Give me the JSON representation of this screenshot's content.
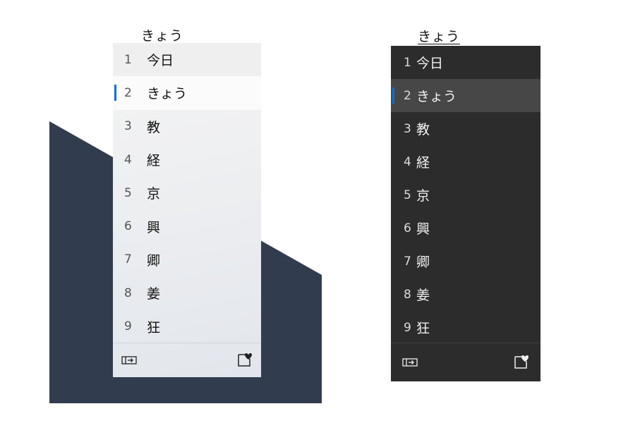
{
  "light_window": {
    "reading": "きょう",
    "candidates": [
      {
        "num": "1",
        "text": "今日"
      },
      {
        "num": "2",
        "text": "きょう"
      },
      {
        "num": "3",
        "text": "教"
      },
      {
        "num": "4",
        "text": "経"
      },
      {
        "num": "5",
        "text": "京"
      },
      {
        "num": "6",
        "text": "興"
      },
      {
        "num": "7",
        "text": "卿"
      },
      {
        "num": "8",
        "text": "姜"
      },
      {
        "num": "9",
        "text": "狂"
      }
    ],
    "selected_index": 2
  },
  "dark_window": {
    "reading": "きょう",
    "candidates": [
      {
        "num": "1",
        "text": "今日"
      },
      {
        "num": "2",
        "text": "きょう"
      },
      {
        "num": "3",
        "text": "教"
      },
      {
        "num": "4",
        "text": "経"
      },
      {
        "num": "5",
        "text": "京"
      },
      {
        "num": "6",
        "text": "興"
      },
      {
        "num": "7",
        "text": "卿"
      },
      {
        "num": "8",
        "text": "姜"
      },
      {
        "num": "9",
        "text": "狂"
      }
    ],
    "selected_index": 2
  },
  "icons": {
    "footer_left": "expand-candidate-window-icon",
    "footer_right": "favorite-emoji-icon"
  },
  "colors": {
    "accent": "#0a6fd1",
    "backdrop": "#323c4f",
    "dark_panel": "#2c2c2c"
  }
}
